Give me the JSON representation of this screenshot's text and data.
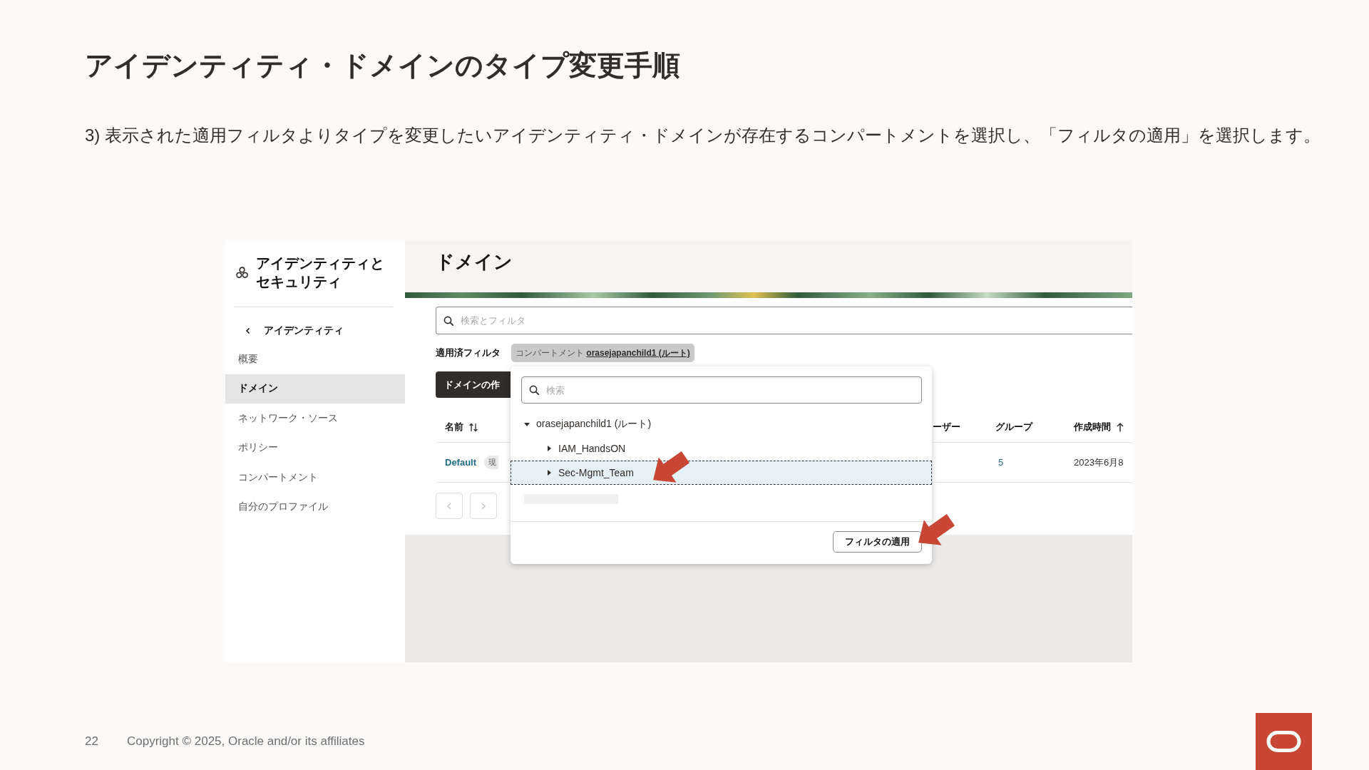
{
  "slide": {
    "title": "アイデンティティ・ドメインのタイプ変更手順",
    "instruction": "3) 表示された適用フィルタよりタイプを変更したいアイデンティティ・ドメインが存在するコンパートメントを選択し、「フィルタの適用」を選択します。"
  },
  "console": {
    "sidebar": {
      "title": "アイデンティティとセキュリティ",
      "back_link": "アイデンティティ",
      "items": [
        {
          "label": "概要",
          "selected": false
        },
        {
          "label": "ドメイン",
          "selected": true
        },
        {
          "label": "ネットワーク・ソース",
          "selected": false
        },
        {
          "label": "ポリシー",
          "selected": false
        },
        {
          "label": "コンパートメント",
          "selected": false
        },
        {
          "label": "自分のプロファイル",
          "selected": false
        }
      ]
    },
    "main": {
      "heading": "ドメイン",
      "search": {
        "placeholder": "検索とフィルタ"
      },
      "applied_filters": {
        "label": "適用済フィルタ",
        "chip": "コンパートメント **orasejapanchild1 (ルート)**"
      },
      "create_button": "ドメインの作",
      "table": {
        "columns": [
          {
            "label": "名前",
            "kind": "sortable"
          },
          {
            "label": "ーザー",
            "kind": "plain"
          },
          {
            "label": "グループ",
            "kind": "plain"
          },
          {
            "label": "作成時間",
            "kind": "ascending"
          }
        ],
        "rows": [
          {
            "name": "Default",
            "tag": "現",
            "groups": "5",
            "created": "2023年6月8"
          }
        ]
      },
      "pagination": [
        {
          "kind": "previous",
          "disabled": true
        },
        {
          "kind": "next",
          "disabled": true
        }
      ]
    },
    "filter_popup": {
      "search": {
        "placeholder": "検索"
      },
      "tree": [
        {
          "label": "orasejapanchild1 (ルート)",
          "expanded": true,
          "selected": false,
          "children": [
            {
              "label": "IAM_HandsON",
              "expanded": false,
              "selected": false
            },
            {
              "label": "Sec-Mgmt_Team",
              "expanded": false,
              "selected": true
            }
          ]
        }
      ],
      "apply_button": "フィルタの適用"
    }
  },
  "footer": {
    "page_number": "22",
    "copyright": "Copyright © 2025, Oracle and/or its affiliates"
  }
}
